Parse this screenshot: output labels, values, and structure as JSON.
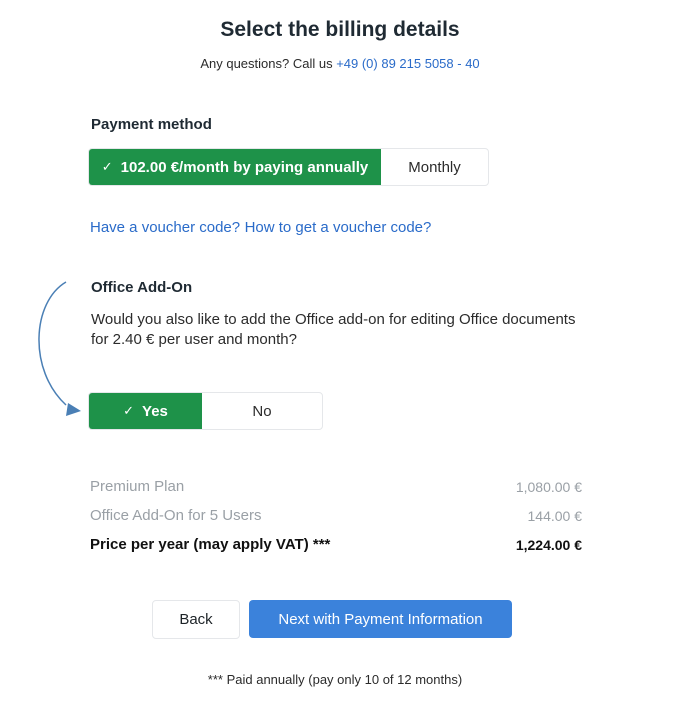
{
  "header": {
    "title": "Select the billing details",
    "subtitle_prefix": "Any questions? Call us ",
    "phone": "+49 (0) 89 215 5058 - 40"
  },
  "payment": {
    "label": "Payment method",
    "annual_label": "102.00 €/month by paying annually",
    "monthly_label": "Monthly",
    "selected": "annual"
  },
  "voucher": {
    "have_code": "Have a voucher code?",
    "how_to": "How to get a voucher code?"
  },
  "addon": {
    "label": "Office Add-On",
    "question": "Would you also like to add the Office add-on for editing Office documents for 2.40 € per user and month?",
    "yes_label": "Yes",
    "no_label": "No",
    "selected": "yes"
  },
  "summary": {
    "rows": [
      {
        "label": "Premium Plan",
        "value": "1,080.00 €"
      },
      {
        "label": "Office Add-On for 5 Users",
        "value": "144.00 €"
      }
    ],
    "total_label": "Price per year (may apply VAT) ***",
    "total_value": "1,224.00 €"
  },
  "actions": {
    "back_label": "Back",
    "next_label": "Next with Payment Information"
  },
  "footnote": "*** Paid annually (pay only 10 of 12 months)",
  "colors": {
    "active_green": "#1e9249",
    "link_blue": "#2a6bc9",
    "primary_blue": "#3b82db",
    "arrow_blue": "#4a7fb5"
  }
}
